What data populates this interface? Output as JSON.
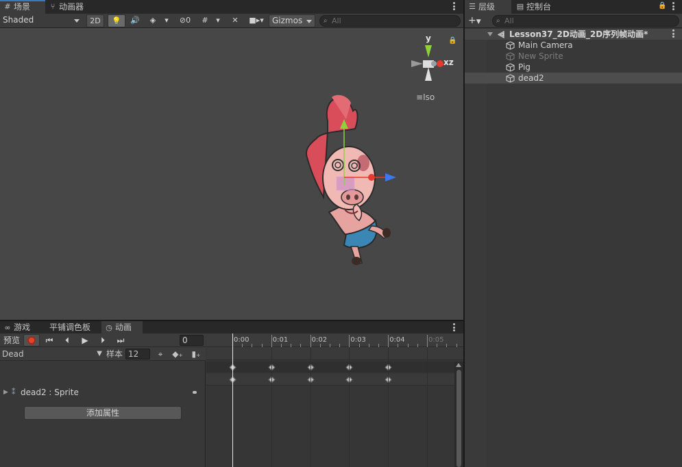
{
  "scene": {
    "tabs": [
      {
        "label": "场景",
        "icon": "scene-grid-icon"
      },
      {
        "label": "动画器",
        "icon": "animator-icon"
      }
    ],
    "toolbar": {
      "shading_mode": "Shaded",
      "mode_2d": "2D",
      "hidden_count": "0",
      "gizmos": "Gizmos",
      "search_placeholder": "All"
    },
    "gizmo": {
      "y": "y",
      "xz": "xz",
      "projection": "Iso"
    }
  },
  "animation": {
    "tabs": [
      {
        "label": "游戏",
        "icon": "game-controller-icon"
      },
      {
        "label": "平铺调色板",
        "icon": ""
      },
      {
        "label": "动画",
        "icon": "animation-clock-icon"
      }
    ],
    "preview_label": "预览",
    "frame": "0",
    "clip": "Dead",
    "sample_label": "样本",
    "sample_rate": "12",
    "property": "dead2 : Sprite",
    "add_property": "添加属性",
    "ruler": [
      "0:00",
      "0:01",
      "0:02",
      "0:03",
      "0:04",
      "0:05"
    ],
    "keyframes_seconds": [
      0,
      1,
      2,
      3,
      4
    ]
  },
  "hierarchy": {
    "tabs": [
      {
        "label": "层级",
        "icon": "hierarchy-list-icon"
      },
      {
        "label": "控制台",
        "icon": "console-icon"
      }
    ],
    "search_placeholder": "All",
    "scene_name": "Lesson37_2D动画_2D序列帧动画*",
    "items": [
      {
        "label": "Main Camera",
        "dim": false,
        "selected": false
      },
      {
        "label": "New Sprite",
        "dim": true,
        "selected": false
      },
      {
        "label": "Pig",
        "dim": false,
        "selected": false
      },
      {
        "label": "dead2",
        "dim": false,
        "selected": true
      }
    ]
  },
  "colors": {
    "selection_accent": "#3a79bb",
    "record_red": "#e9402c",
    "gizmo_y_green": "#8ed23a",
    "gizmo_x_red": "#e63a2f",
    "gizmo_z_blue": "#3a7af0"
  }
}
